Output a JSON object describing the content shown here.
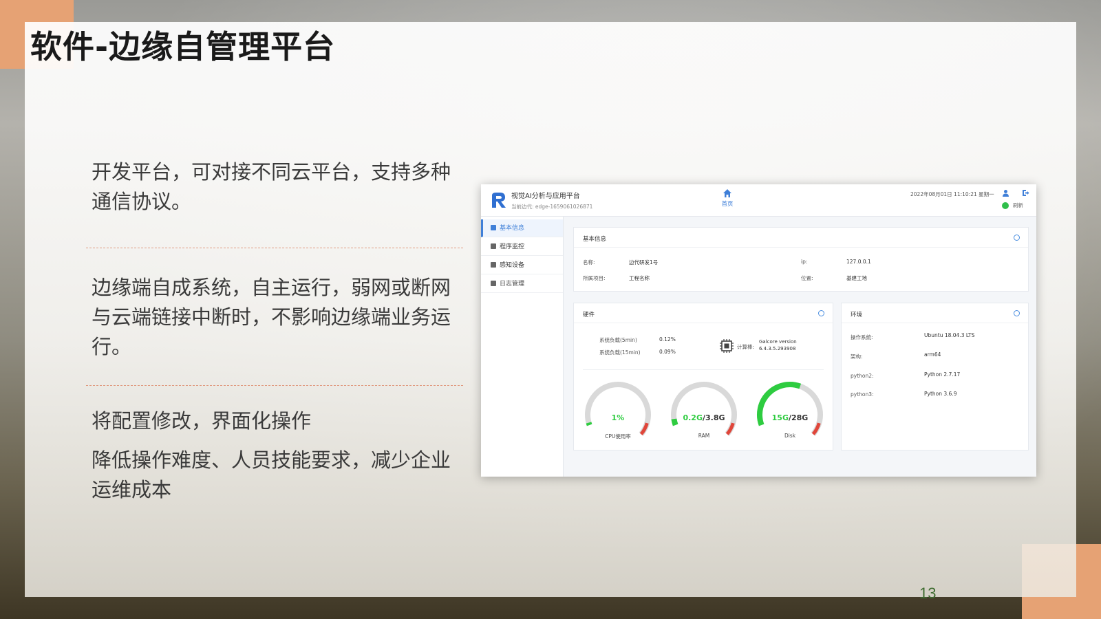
{
  "slide": {
    "title": "软件-边缘自管理平台",
    "paragraphs": [
      "开发平台，可对接不同云平台，支持多种通信协议。",
      "边缘端自成系统，自主运行，弱网或断网与云端链接中断时，不影响边缘端业务运行。",
      "将配置修改，界面化操作",
      "降低操作难度、人员技能要求，减少企业运维成本"
    ],
    "page_number": "13"
  },
  "colors": {
    "accent": "#e6a274",
    "primary_blue": "#3f7fd8",
    "gauge_green": "#2ecc40",
    "gauge_track": "#d9d9d9",
    "gauge_red": "#e0463a"
  },
  "app": {
    "title": "视觉AI分析与应用平台",
    "current_edge": "当前边代: edge-1659061026871",
    "home_label": "首页",
    "datetime": "2022年08月01日 11:10:21 星期一",
    "refresh_label": "刷新",
    "icons": [
      "logo-icon",
      "home-icon",
      "user-icon",
      "logout-icon",
      "status-ok-icon",
      "refresh-icon",
      "chip-icon"
    ],
    "sidebar": [
      {
        "label": "基本信息",
        "active": true
      },
      {
        "label": "程序监控",
        "active": false
      },
      {
        "label": "感知设备",
        "active": false
      },
      {
        "label": "日志管理",
        "active": false
      }
    ],
    "basic_info": {
      "title": "基本信息",
      "name_key": "名称:",
      "name_val": "边代研发1号",
      "ip_key": "ip:",
      "ip_val": "127.0.0.1",
      "project_key": "所属项目:",
      "project_val": "工程名称",
      "location_key": "位置:",
      "location_val": "基建工地"
    },
    "hardware": {
      "title": "硬件",
      "load5_key": "系统负载(5min)",
      "load5_val": "0.12%",
      "load15_key": "系统负载(15min)",
      "load15_val": "0.09%",
      "compute_key": "计算棒:",
      "compute_val1": "Galcore version",
      "compute_val2": "6.4.3.5.293908",
      "gauges": [
        {
          "value_text": "1%",
          "label": "CPU使用率",
          "fraction": 0.01
        },
        {
          "value_text": "0.2G",
          "total_text": "/3.8G",
          "label": "RAM",
          "fraction": 0.05
        },
        {
          "value_text": "15G",
          "total_text": "/28G",
          "label": "Disk",
          "fraction": 0.54
        }
      ]
    },
    "environment": {
      "title": "环境",
      "os_key": "操作系统:",
      "os_val": "Ubuntu 18.04.3 LTS",
      "arch_key": "架构:",
      "arch_val": "arm64",
      "py2_key": "python2:",
      "py2_val": "Python 2.7.17",
      "py3_key": "python3:",
      "py3_val": "Python 3.6.9"
    }
  }
}
